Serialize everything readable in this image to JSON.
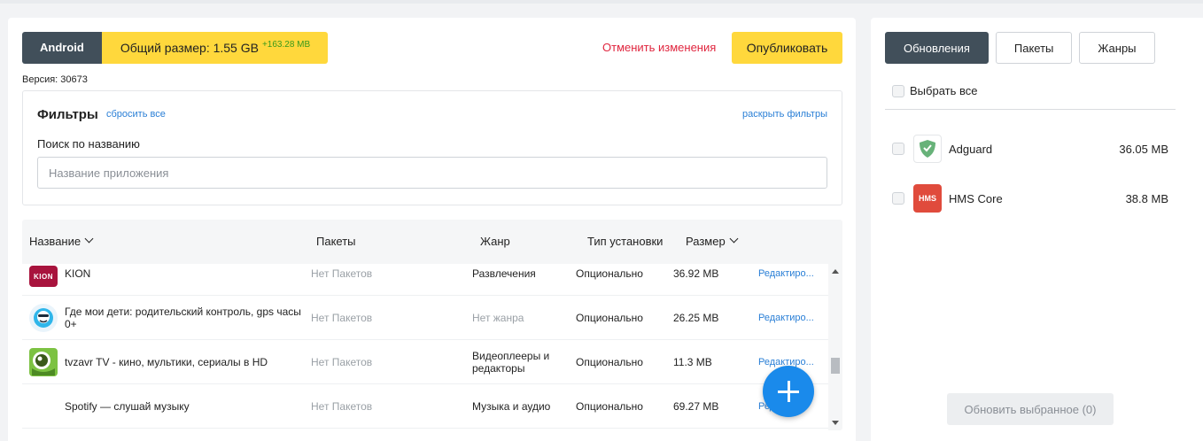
{
  "header": {
    "platform": "Android",
    "size_label": "Общий размер: 1.55 GB",
    "size_delta": "+163.28 MB",
    "cancel_label": "Отменить изменения",
    "publish_label": "Опубликовать",
    "version": "Версия: 30673"
  },
  "filters": {
    "title": "Фильтры",
    "reset_label": "сбросить все",
    "expand_label": "раскрыть фильтры",
    "search_label": "Поиск по названию",
    "search_placeholder": "Название приложения",
    "search_value": ""
  },
  "table": {
    "columns": {
      "name": "Название",
      "packages": "Пакеты",
      "genre": "Жанр",
      "install_type": "Тип установки",
      "size": "Размер"
    },
    "rows": [
      {
        "name": "KION",
        "packages": "Нет Пакетов",
        "genre": "Развлечения",
        "genre_muted": false,
        "install_type": "Опционально",
        "size": "36.92 MB",
        "edit": "Редактиро...",
        "icon": "kion-icon",
        "icon_text": "KION"
      },
      {
        "name": "Где мои дети: родительский контроль, gps часы 0+",
        "packages": "Нет Пакетов",
        "genre": "Нет жанра",
        "genre_muted": true,
        "install_type": "Опционально",
        "size": "26.25 MB",
        "edit": "Редактиро...",
        "icon": "find-my-kids-icon"
      },
      {
        "name": "tvzavr TV - кино, мультики, сериалы в HD",
        "packages": "Нет Пакетов",
        "genre": "Видеоплееры и редакторы",
        "genre_muted": false,
        "install_type": "Опционально",
        "size": "11.3 MB",
        "edit": "Редактиро...",
        "icon": "tvzavr-icon"
      },
      {
        "name": "Spotify — слушай музыку",
        "packages": "Нет Пакетов",
        "genre": "Музыка и аудио",
        "genre_muted": false,
        "install_type": "Опционально",
        "size": "69.27 MB",
        "edit": "Редакти",
        "icon": "spotify-icon"
      }
    ]
  },
  "sidebar": {
    "tabs": [
      "Обновления",
      "Пакеты",
      "Жанры"
    ],
    "select_all_label": "Выбрать все",
    "updates": [
      {
        "name": "Adguard",
        "size": "36.05 MB",
        "icon": "adguard-icon"
      },
      {
        "name": "HMS Core",
        "size": "38.8 MB",
        "icon": "hms-core-icon",
        "icon_text": "HMS"
      }
    ],
    "update_button_label": "Обновить выбранное (0)"
  },
  "colors": {
    "accent_yellow": "#ffd83c",
    "dark_slate": "#414f5a",
    "link_blue": "#2a7fd6",
    "danger_red": "#e0253e",
    "fab_blue": "#1a8aeb"
  }
}
